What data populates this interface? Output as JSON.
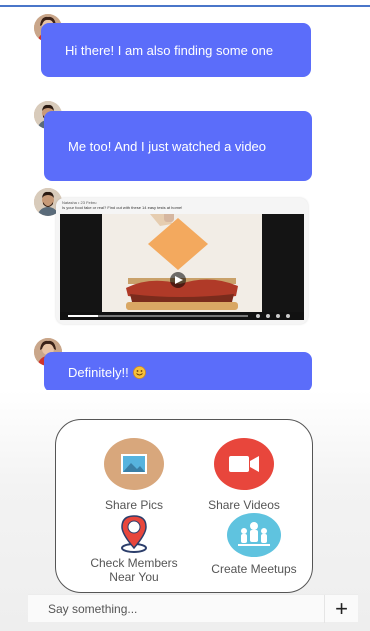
{
  "messages": [
    {
      "text": "Hi there! I am also finding some one"
    },
    {
      "text": "Me too! And I just watched a video"
    },
    {
      "text": "Definitely!!"
    }
  ],
  "video": {
    "poster_name": "Natasha • 23 Febru",
    "description": "Is your food fake or real? Find out with these 14 easy tests at home!"
  },
  "actions": {
    "share_pics": "Share Pics",
    "share_videos": "Share Videos",
    "check_members_line1": "Check Members",
    "check_members_line2": "Near You",
    "create_meetups": "Create Meetups"
  },
  "input": {
    "placeholder": "Say something...",
    "add_symbol": "+"
  },
  "colors": {
    "bubble": "#5b6dfa",
    "share_pics_bg": "#d8a77c",
    "share_videos_bg": "#e8463c",
    "meetups_bg": "#5fc3df"
  }
}
